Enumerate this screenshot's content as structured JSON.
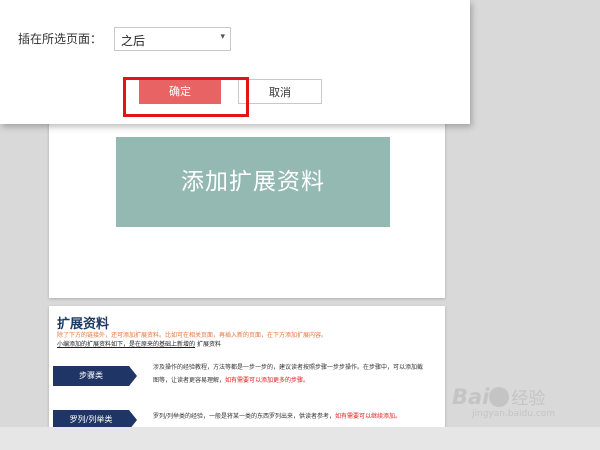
{
  "dialog": {
    "insert_label": "插在所选页面：",
    "position_select_value": "之后",
    "ok_label": "确定",
    "cancel_label": "取消"
  },
  "slide1": {
    "banner_text": "添加扩展资料"
  },
  "slide2": {
    "title": "扩展资料",
    "intro_line": "除了下方的链接外，还可添加扩展资料。比如可在相关页面，再插入新的页面，在下方添加扩展内容。",
    "subtitle_prefix": "小编添加的扩展资料如下，是在原来的基础上新增的",
    "subtitle_link": "扩展资料",
    "tags": [
      "步骤类",
      "罗列/列举类"
    ],
    "desc1_text": "涉及操作的经验教程，方法等都是一步一步的，建议读者按照步骤一步步操作。在步骤中，可以添加截图等，让读者更容易理解，",
    "desc1_red": "如有需要可以添加更多的步骤。",
    "desc2_text": "罗列/列举类的经验，一般是将某一类的东西罗列出来，供读者参考，",
    "desc2_red": "如有需要可以继续添加。"
  },
  "watermark": {
    "brand": "Bai",
    "brand_suffix": "经验",
    "url": "jingyan.baidu.com"
  }
}
